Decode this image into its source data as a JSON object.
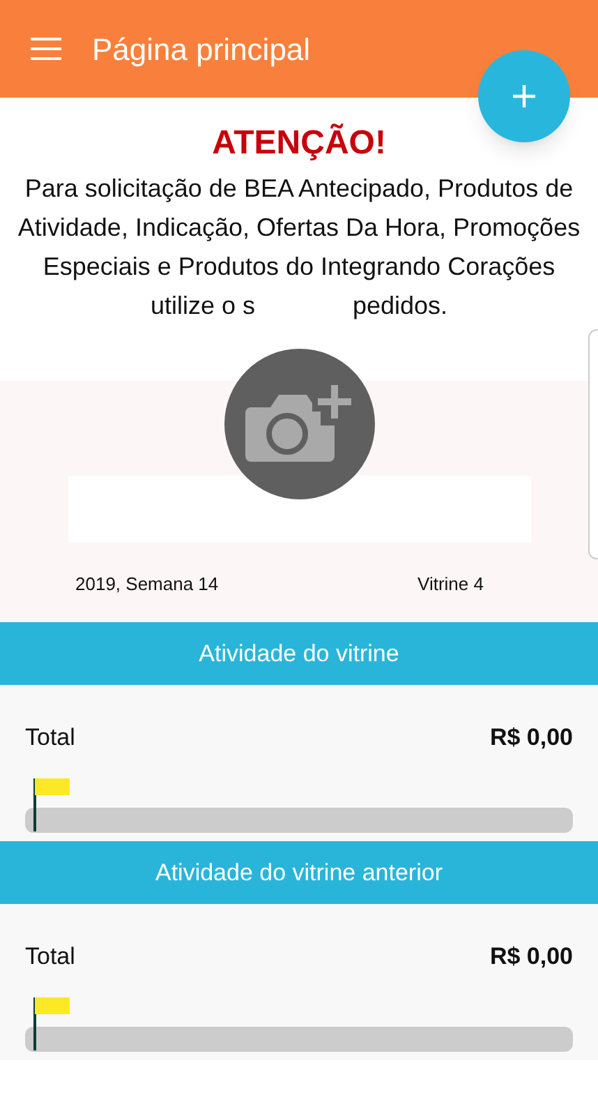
{
  "app_bar": {
    "title": "Página principal"
  },
  "notice": {
    "title": "ATENÇÃO!",
    "text": "Para solicitação de BEA Antecipado, Produtos de Atividade, Indicação, Ofertas Da Hora, Promoções Especiais e Produtos do Integrando Corações",
    "last_line_start": "utilize o s",
    "last_line_end": "pedidos."
  },
  "showcase": {
    "week": "2019, Semana 14",
    "vitrine": "Vitrine 4"
  },
  "sections": [
    {
      "title": "Atividade do vitrine",
      "label": "Total",
      "amount": "R$ 0,00",
      "level": 0
    },
    {
      "title": "Atividade do vitrine anterior",
      "label": "Total",
      "amount": "R$ 0,00",
      "level": 0
    }
  ]
}
